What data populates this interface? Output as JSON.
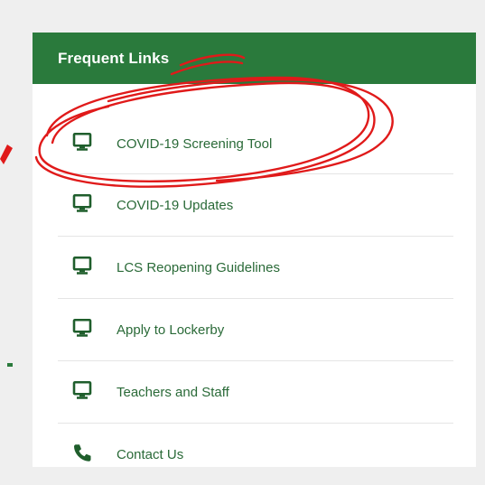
{
  "colors": {
    "header_bg": "#2a7a3c",
    "link_text": "#2a6a38",
    "icon": "#1f5e2c",
    "annotation": "#e01a1a",
    "background": "#efefef"
  },
  "panel": {
    "title": "Frequent Links",
    "links": [
      {
        "label": "COVID-19 Screening Tool",
        "icon": "monitor-icon"
      },
      {
        "label": "COVID-19 Updates",
        "icon": "monitor-icon"
      },
      {
        "label": "LCS Reopening Guidelines",
        "icon": "monitor-icon"
      },
      {
        "label": "Apply to Lockerby",
        "icon": "monitor-icon"
      },
      {
        "label": "Teachers and Staff",
        "icon": "monitor-icon"
      },
      {
        "label": "Contact Us",
        "icon": "phone-icon"
      }
    ]
  }
}
